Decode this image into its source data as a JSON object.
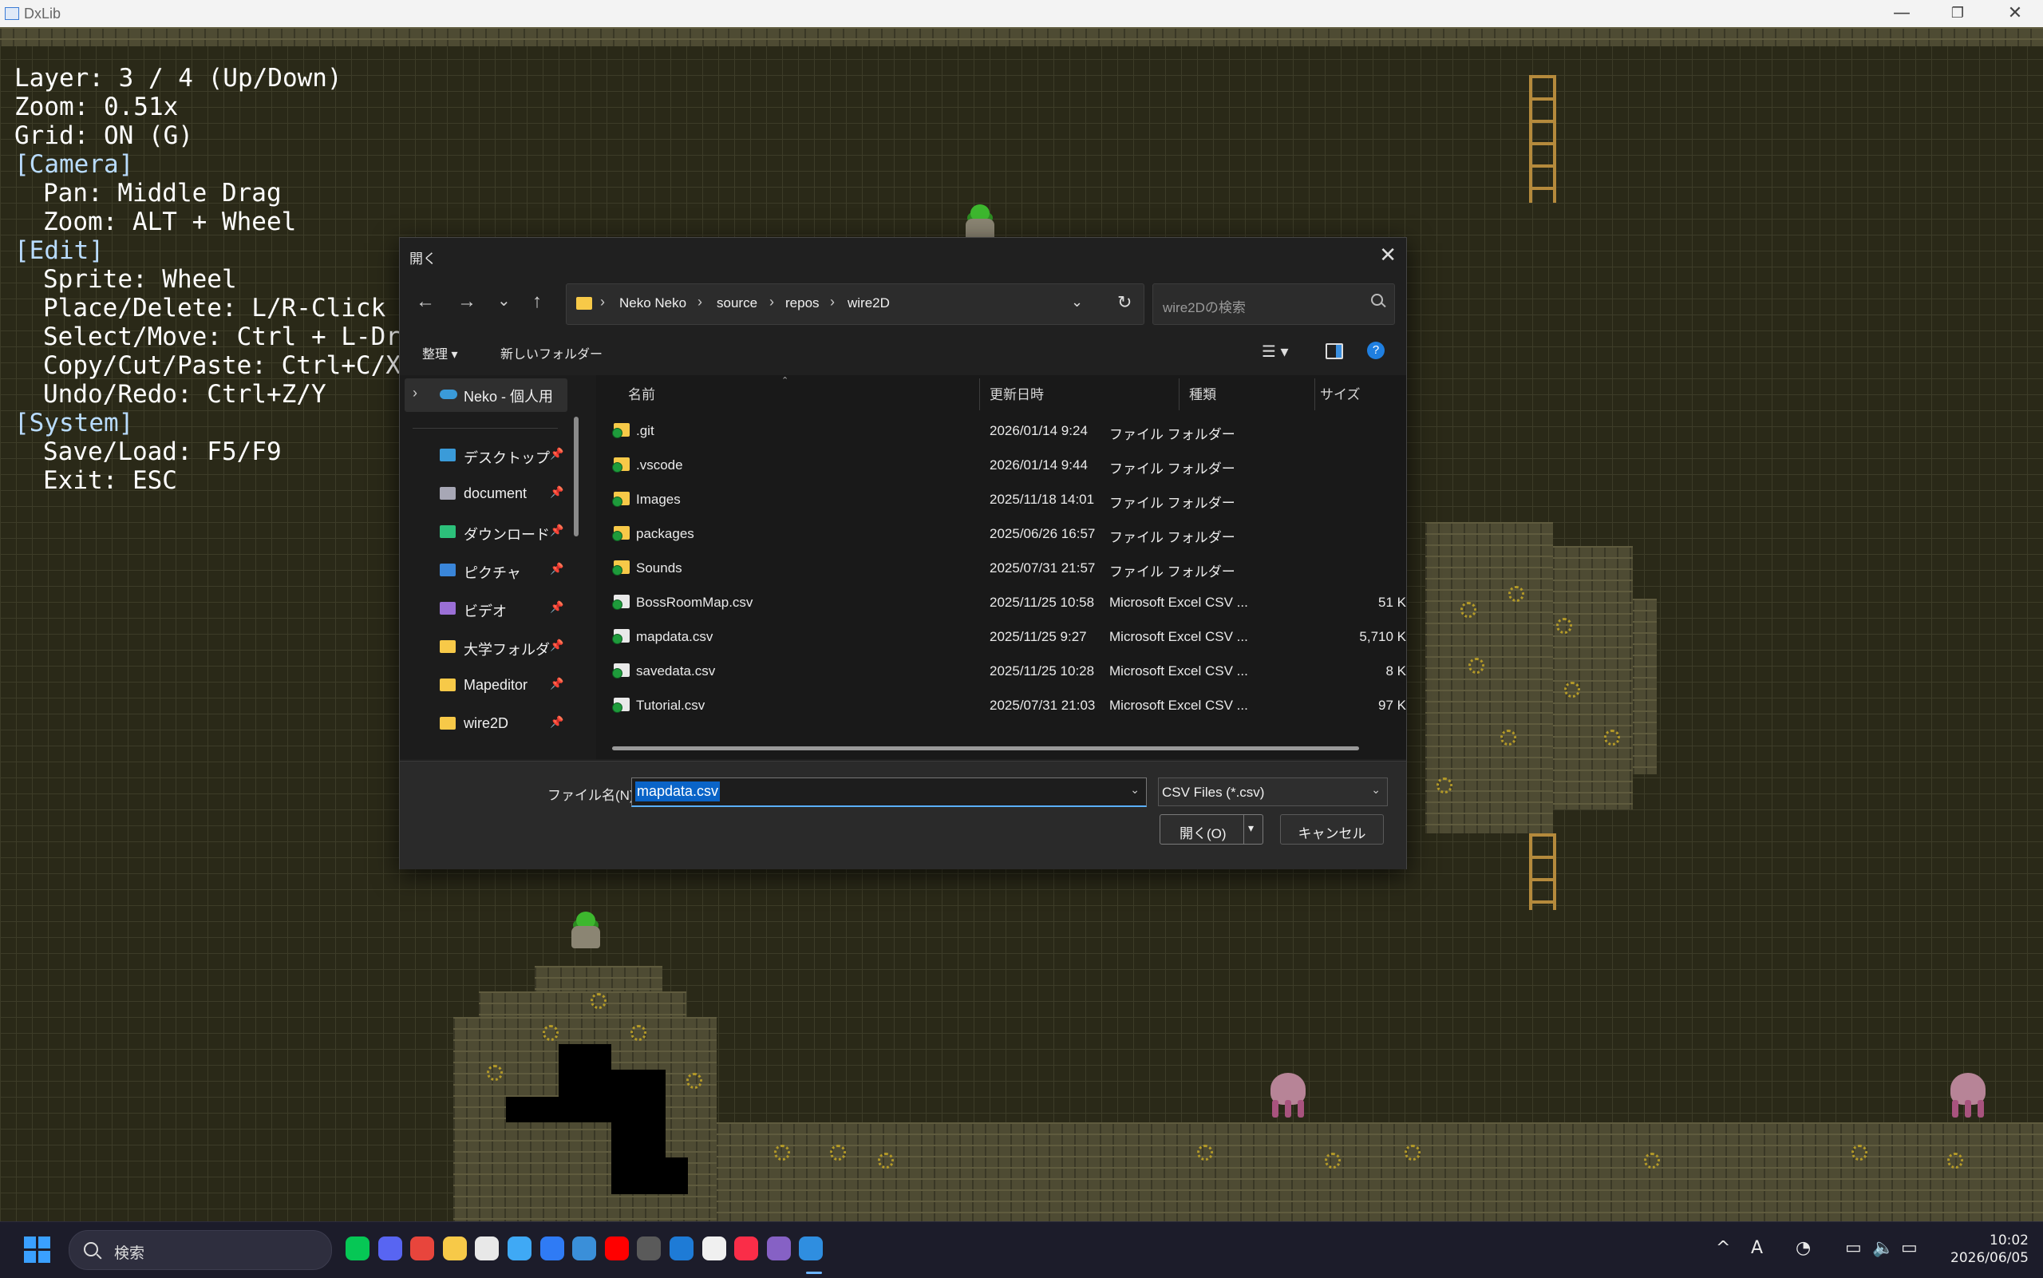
{
  "window": {
    "title": "DxLib",
    "minimize": "—",
    "maximize": "❐",
    "close": "✕"
  },
  "help": {
    "lines": [
      {
        "text": "Layer: 3 / 4 (Up/Down)",
        "heading": false,
        "indent": false
      },
      {
        "text": "Zoom: 0.51x",
        "heading": false,
        "indent": false
      },
      {
        "text": "Grid: ON (G)",
        "heading": false,
        "indent": false
      },
      {
        "text": "[Camera]",
        "heading": true,
        "indent": false
      },
      {
        "text": "Pan: Middle Drag",
        "heading": false,
        "indent": true
      },
      {
        "text": "Zoom: ALT + Wheel",
        "heading": false,
        "indent": true
      },
      {
        "text": "[Edit]",
        "heading": true,
        "indent": false
      },
      {
        "text": "Sprite: Wheel",
        "heading": false,
        "indent": true
      },
      {
        "text": "Place/Delete: L/R-Click",
        "heading": false,
        "indent": true
      },
      {
        "text": "Select/Move: Ctrl + L-Drag",
        "heading": false,
        "indent": true
      },
      {
        "text": "Copy/Cut/Paste: Ctrl+C/X/V",
        "heading": false,
        "indent": true
      },
      {
        "text": "Undo/Redo: Ctrl+Z/Y",
        "heading": false,
        "indent": true
      },
      {
        "text": "[System]",
        "heading": true,
        "indent": false
      },
      {
        "text": "Save/Load: F5/F9",
        "heading": false,
        "indent": true
      },
      {
        "text": "Exit: ESC",
        "heading": false,
        "indent": true
      }
    ]
  },
  "dialog": {
    "title": "開く",
    "close": "✕",
    "nav": {
      "back": "←",
      "forward": "→",
      "recent": "⌄",
      "up": "↑"
    },
    "breadcrumb": [
      "Neko Neko",
      "source",
      "repos",
      "wire2D"
    ],
    "breadcrumb_sep": "›",
    "search_placeholder": "wire2Dの検索",
    "commands": {
      "organize": "整理 ▾",
      "new_folder": "新しいフォルダー"
    },
    "nav_pane": {
      "onedrive": "Neko - 個人用",
      "items": [
        {
          "label": "デスクトップ",
          "icon": "desktop-icon",
          "color": "#3a9bd9"
        },
        {
          "label": "document",
          "icon": "document-icon",
          "color": "#a7a7b5"
        },
        {
          "label": "ダウンロード",
          "icon": "download-icon",
          "color": "#2cc07a"
        },
        {
          "label": "ピクチャ",
          "icon": "pictures-icon",
          "color": "#3a86d9"
        },
        {
          "label": "ビデオ",
          "icon": "videos-icon",
          "color": "#9a6fd6"
        },
        {
          "label": "大学フォルダ",
          "icon": "folder-icon",
          "color": "#f7c948"
        },
        {
          "label": "Mapeditor",
          "icon": "folder-icon",
          "color": "#f7c948"
        },
        {
          "label": "wire2D",
          "icon": "folder-icon",
          "color": "#f7c948"
        }
      ],
      "pin": "📌"
    },
    "columns": {
      "name": "名前",
      "modified": "更新日時",
      "type": "種類",
      "size": "サイズ"
    },
    "files": [
      {
        "name": ".git",
        "modified": "2026/01/14 9:24",
        "type": "ファイル フォルダー",
        "size": "",
        "kind": "folder"
      },
      {
        "name": ".vscode",
        "modified": "2026/01/14 9:44",
        "type": "ファイル フォルダー",
        "size": "",
        "kind": "folder"
      },
      {
        "name": "Images",
        "modified": "2025/11/18 14:01",
        "type": "ファイル フォルダー",
        "size": "",
        "kind": "folder"
      },
      {
        "name": "packages",
        "modified": "2025/06/26 16:57",
        "type": "ファイル フォルダー",
        "size": "",
        "kind": "folder"
      },
      {
        "name": "Sounds",
        "modified": "2025/07/31 21:57",
        "type": "ファイル フォルダー",
        "size": "",
        "kind": "folder"
      },
      {
        "name": "BossRoomMap.csv",
        "modified": "2025/11/25 10:58",
        "type": "Microsoft Excel CSV ...",
        "size": "51 K",
        "kind": "csv"
      },
      {
        "name": "mapdata.csv",
        "modified": "2025/11/25 9:27",
        "type": "Microsoft Excel CSV ...",
        "size": "5,710 K",
        "kind": "csv"
      },
      {
        "name": "savedata.csv",
        "modified": "2025/11/25 10:28",
        "type": "Microsoft Excel CSV ...",
        "size": "8 K",
        "kind": "csv"
      },
      {
        "name": "Tutorial.csv",
        "modified": "2025/07/31 21:03",
        "type": "Microsoft Excel CSV ...",
        "size": "97 K",
        "kind": "csv"
      }
    ],
    "filename_label": "ファイル名(N):",
    "filename_value": "mapdata.csv",
    "filetype": "CSV Files (*.csv)",
    "open_button": "開く(O)",
    "cancel_button": "キャンセル"
  },
  "taskbar": {
    "search_label": "検索",
    "apps": [
      {
        "name": "line-icon",
        "color": "#06c755"
      },
      {
        "name": "discord-icon",
        "color": "#5865f2"
      },
      {
        "name": "chrome-icon",
        "color": "#e8453c"
      },
      {
        "name": "file-explorer-icon",
        "color": "#f7c948"
      },
      {
        "name": "slack-icon",
        "color": "#e8e8e8"
      },
      {
        "name": "notepad-icon",
        "color": "#3fa9f5"
      },
      {
        "name": "copilot-icon",
        "color": "#2f7bf5"
      },
      {
        "name": "photos-icon",
        "color": "#3a8fd9"
      },
      {
        "name": "youtube-icon",
        "color": "#ff0000"
      },
      {
        "name": "unity-icon",
        "color": "#5a5a5a"
      },
      {
        "name": "outlook-icon",
        "color": "#1e7bd6"
      },
      {
        "name": "store-icon",
        "color": "#f0f0f0"
      },
      {
        "name": "music-icon",
        "color": "#fa2d48"
      },
      {
        "name": "visual-studio-icon",
        "color": "#8661c5"
      },
      {
        "name": "dxlib-app-icon",
        "color": "#2f8ee0"
      }
    ],
    "tray": {
      "chevron": "^",
      "ime": "A",
      "clock_icon": "◔",
      "net": "▭",
      "vol": "🔈",
      "battery": "▭"
    },
    "time": "10:02",
    "date": "2026/06/05"
  }
}
